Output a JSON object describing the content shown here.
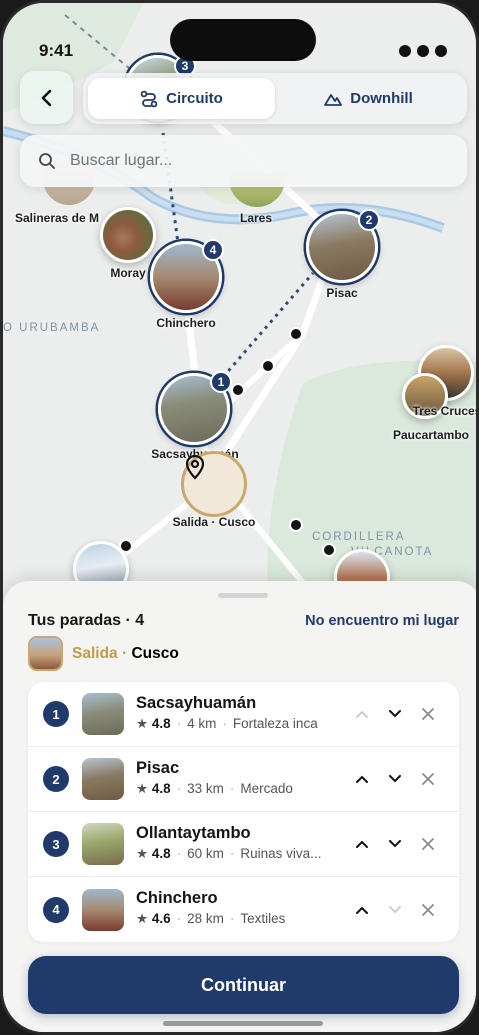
{
  "status": {
    "time": "9:41"
  },
  "colors": {
    "navy": "#1f3a6b",
    "gold": "#c49a45",
    "river": "#a9c9e4",
    "park": "#d8e8db"
  },
  "tabs": [
    {
      "label": "Circuito",
      "icon": "route-icon",
      "active": true
    },
    {
      "label": "Downhill",
      "icon": "mountain-icon",
      "active": false
    }
  ],
  "search": {
    "placeholder": "Buscar lugar..."
  },
  "map": {
    "labels": {
      "salineras": "Salineras de M",
      "moray": "Moray",
      "lares": "Lares",
      "pisac": "Pisac",
      "chinchero": "Chinchero",
      "sacsayhuaman": "Sacsayhuamán",
      "tres_cruces": "Tres Cruces",
      "paucartambo": "Paucartambo",
      "origin": "Salida · Cusco"
    },
    "regions": {
      "urubamba": "O URUBAMBA",
      "cordillera": "CORDILLERA",
      "cordillera2": "VILCANOTA"
    },
    "badges": {
      "top": "3",
      "pisac": "2",
      "chinchero": "4",
      "sacsayhuaman": "1"
    }
  },
  "sheet": {
    "title": "Tus paradas · 4",
    "link": "No encuentro mi lugar",
    "origin_prefix": "Salida",
    "origin_sep": " · ",
    "origin_city": "Cusco",
    "stops": [
      {
        "n": "1",
        "name": "Sacsayhuamán",
        "rating": "4.8",
        "distance": "4 km",
        "category": "Fortaleza inca"
      },
      {
        "n": "2",
        "name": "Pisac",
        "rating": "4.8",
        "distance": "33 km",
        "category": "Mercado"
      },
      {
        "n": "3",
        "name": "Ollantaytambo",
        "rating": "4.8",
        "distance": "60 km",
        "category": "Ruinas viva..."
      },
      {
        "n": "4",
        "name": "Chinchero",
        "rating": "4.6",
        "distance": "28 km",
        "category": "Textiles"
      }
    ],
    "cta": "Continuar"
  }
}
